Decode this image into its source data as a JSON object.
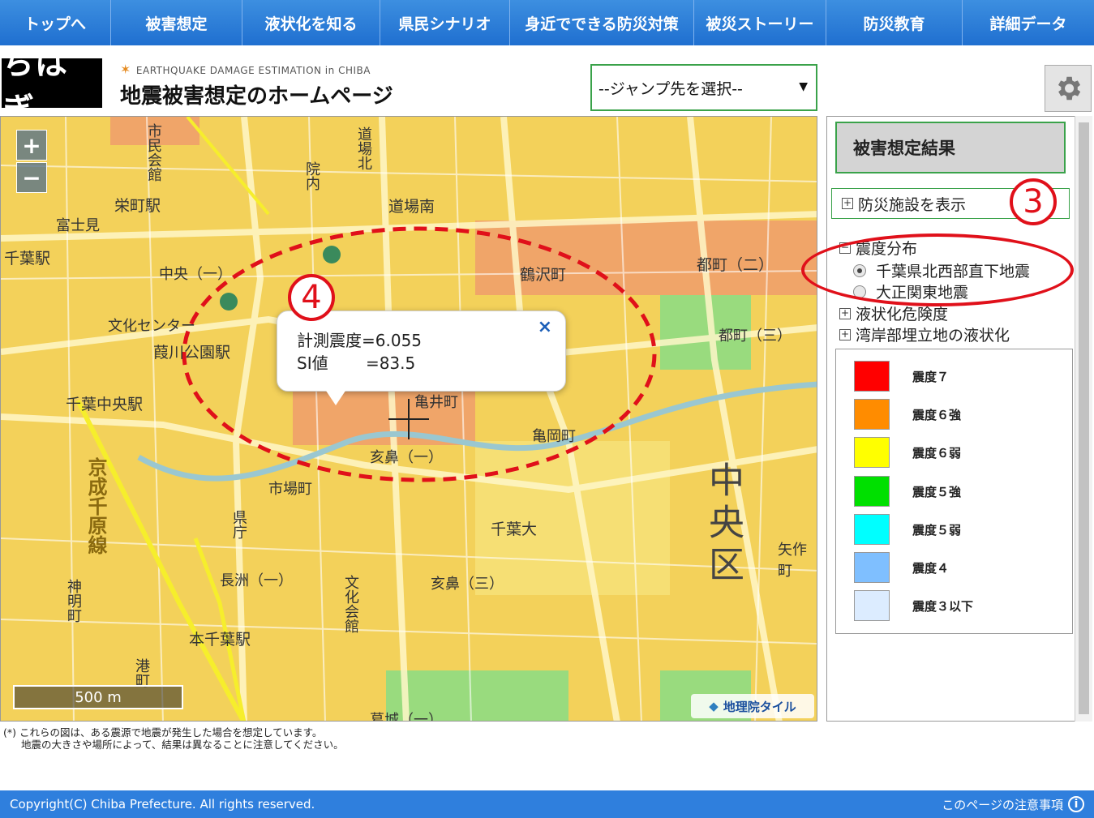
{
  "nav": [
    "トップへ",
    "被害想定",
    "液状化を知る",
    "県民シナリオ",
    "身近でできる防災対策",
    "被災ストーリー",
    "防災教育",
    "詳細データ"
  ],
  "header": {
    "logo_text": "ちばぎ",
    "subtitle": "EARTHQUAKE DAMAGE ESTIMATION in CHIBA",
    "title": "地震被害想定のホームページ",
    "jump_placeholder": "--ジャンプ先を選択--"
  },
  "map": {
    "scale_label": "500 m",
    "attribution": "地理院タイル",
    "district_label": "中央区",
    "place_labels": [
      "市民会館",
      "栄町駅",
      "富士見",
      "千葉駅",
      "道場南",
      "道場北",
      "院内",
      "中央（一）",
      "文化センター",
      "葭川公園駅",
      "千葉中央駅",
      "鶴沢町",
      "都町（二）",
      "都町（三）",
      "亀井町",
      "亀岡町",
      "市場町",
      "県庁",
      "千葉大",
      "京成千原線",
      "本千葉駅",
      "長洲（一）",
      "亥鼻（一）",
      "亥鼻（三）",
      "文化会館",
      "葛城（一）",
      "矢作町",
      "神明町",
      "港町"
    ],
    "popup": {
      "line1": "計測震度=6.055",
      "line2": "SI値　　 =83.5",
      "close": "×"
    }
  },
  "panel": {
    "results_button": "被害想定結果",
    "facilities_toggle": "防災施設を表示",
    "shindo_group": "震度分布",
    "radio1": "千葉県北西部直下地震",
    "radio2": "大正関東地震",
    "liquefaction": "液状化危険度",
    "bay_liquefaction": "湾岸部埋立地の液状化",
    "annotation3": "3",
    "annotation4": "4"
  },
  "legend": [
    {
      "label": "震度７",
      "color": "#ff0000"
    },
    {
      "label": "震度６強",
      "color": "#ff8c00"
    },
    {
      "label": "震度６弱",
      "color": "#ffff00"
    },
    {
      "label": "震度５強",
      "color": "#00e000"
    },
    {
      "label": "震度５弱",
      "color": "#00ffff"
    },
    {
      "label": "震度４",
      "color": "#7fbfff"
    },
    {
      "label": "震度３以下",
      "color": "#dcecff"
    }
  ],
  "footnote": {
    "line1": "(*) これらの図は、ある震源で地震が発生した場合を想定しています。",
    "line2": "地震の大きさや場所によって、結果は異なることに注意してください。"
  },
  "footer": {
    "copyright": "Copyright(C) Chiba Prefecture. All rights reserved.",
    "notes_link": "このページの注意事項",
    "info_glyph": "i"
  }
}
